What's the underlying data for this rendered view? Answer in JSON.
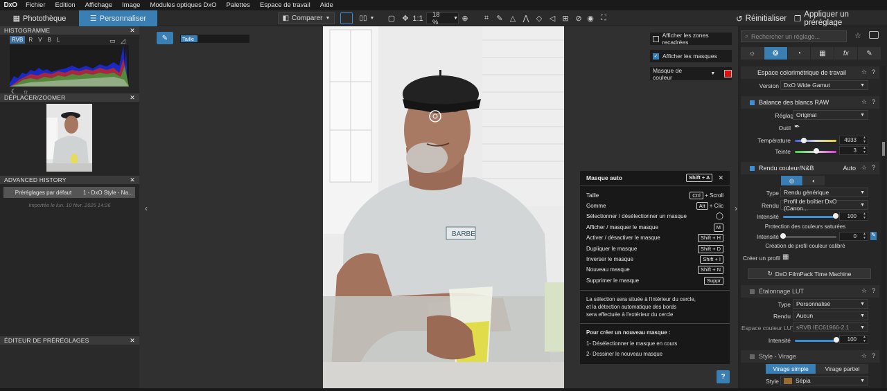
{
  "menubar": {
    "logo": "DxO",
    "items": [
      "Fichier",
      "Edition",
      "Affichage",
      "Image",
      "Modules optiques DxO",
      "Palettes",
      "Espace de travail",
      "Aide"
    ]
  },
  "toolbar": {
    "tab_library": "Photothèque",
    "tab_customize": "Personnaliser",
    "compare": "Comparer",
    "zoom_one": "1:1",
    "zoom_level": "18 %",
    "reset": "Réinitialiser",
    "apply_preset": "Appliquer un préréglage"
  },
  "left": {
    "histogram_title": "HISTOGRAMME",
    "hist_channels": [
      "RVB",
      "R",
      "V",
      "B",
      "L"
    ],
    "navigator_title": "DÉPLACER/ZOOMER",
    "history_title": "ADVANCED HISTORY",
    "history_preset": "Préréglages par défaut",
    "history_style": "1 - DxO Style - Na...",
    "history_note": "Importée le lun. 10 févr. 2025 14:26",
    "preset_editor_title": "ÉDITEUR DE PRÉRÉGLAGES"
  },
  "mask_tool": {
    "size_label": "Taille",
    "show_cropped": "Afficher les zones recadrées",
    "show_masks": "Afficher les masques",
    "mask_color": "Masque de couleur",
    "mask_color_hex": "#e01010"
  },
  "shortcuts": {
    "title": "Masque auto",
    "title_key": "Shift + A",
    "rows": [
      {
        "label": "Taille",
        "key": "Ctrl",
        "suffix": "+ Scroll"
      },
      {
        "label": "Gomme",
        "key": "Alt",
        "suffix": "+ Clic"
      },
      {
        "label": "Sélectionner / désélectionner un masque",
        "key": "",
        "suffix": ""
      },
      {
        "label": "Afficher / masquer le masque",
        "key": "M",
        "suffix": ""
      },
      {
        "label": "Activer / désactiver le masque",
        "key": "Shift + H",
        "suffix": ""
      },
      {
        "label": "Dupliquer le masque",
        "key": "Shift + D",
        "suffix": ""
      },
      {
        "label": "Inverser le masque",
        "key": "Shift + I",
        "suffix": ""
      },
      {
        "label": "Nouveau masque",
        "key": "Shift + N",
        "suffix": ""
      },
      {
        "label": "Supprimer le masque",
        "key": "Suppr",
        "suffix": ""
      }
    ],
    "info_1": "La sélection sera située à l'intérieur du cercle,",
    "info_2": "et la détection automatique des bords",
    "info_3": "sera effectuée à l'extérieur du cercle",
    "new_mask_title": "Pour créer un nouveau masque :",
    "step_1": "1- Désélectionner le masque en cours",
    "step_2": "2- Dessiner le nouveau masque",
    "help": "?"
  },
  "right": {
    "search_placeholder": "Rechercher un réglage...",
    "colorspace": {
      "title": "Espace colorimétrique de travail",
      "version_label": "Version",
      "version_value": "DxO Wide Gamut"
    },
    "wb": {
      "title": "Balance des blancs RAW",
      "setting_label": "Réglage",
      "setting_value": "Original",
      "tool_label": "Outil",
      "temp_label": "Température",
      "temp_value": "4933",
      "temp_level": 0.22,
      "tint_label": "Teinte",
      "tint_value": "3",
      "tint_level": 0.52
    },
    "rendering": {
      "title": "Rendu couleur/N&B",
      "auto": "Auto",
      "type_label": "Type",
      "type_value": "Rendu générique",
      "render_label": "Rendu",
      "render_value": "Profil de boîtier DxO (Canon...",
      "intensity_label": "Intensité",
      "intensity_value": "100",
      "protection_title": "Protection des couleurs saturées",
      "protection_intensity_label": "Intensité",
      "protection_value": "0",
      "profile_title": "Création de profil couleur calibré",
      "create_profile": "Créer un profil",
      "filmpack_button": "DxO FilmPack Time Machine"
    },
    "lut": {
      "title": "Étalonnage LUT",
      "type_label": "Type",
      "type_value": "Personnalisé",
      "render_label": "Rendu",
      "render_value": "Aucun",
      "space_label": "Espace couleur LUT",
      "space_value": "sRVB IEC61966-2.1",
      "intensity_label": "Intensité",
      "intensity_value": "100"
    },
    "style": {
      "title": "Style - Virage",
      "tab_simple": "Virage simple",
      "tab_partial": "Virage partiel",
      "style_label": "Style",
      "style_value": "Sépia"
    }
  }
}
